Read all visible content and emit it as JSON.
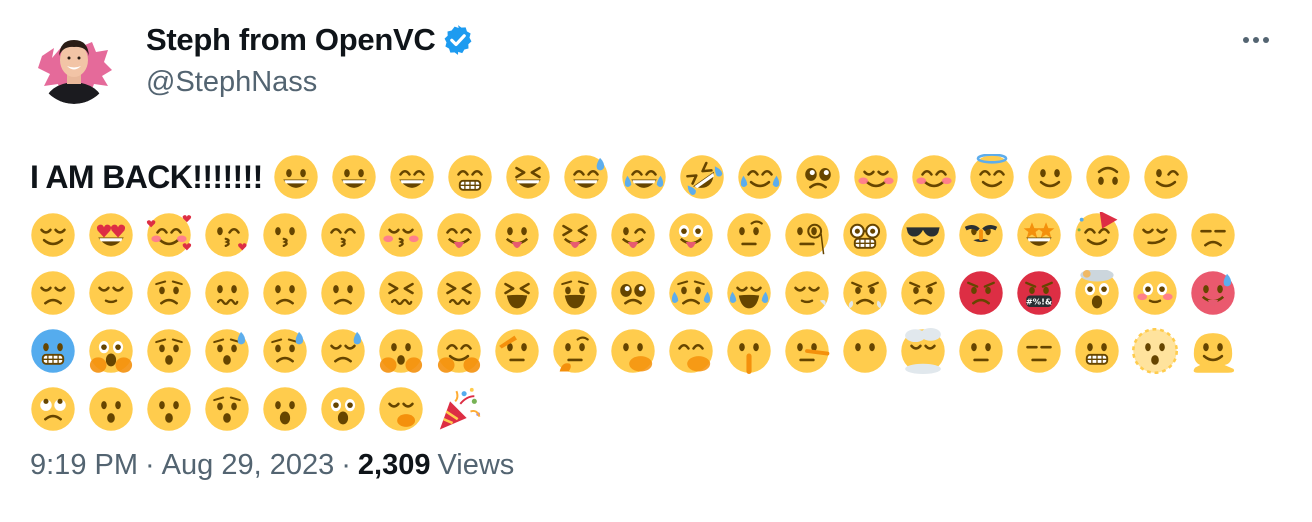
{
  "author": {
    "name": "Steph from OpenVC",
    "handle": "@StephNass",
    "verified": true
  },
  "tweet": {
    "text": "I AM BACK!!!!!!!",
    "emoji_rows": [
      [
        "grinning",
        "smiley",
        "smile",
        "grin",
        "laughing",
        "sweat-smile",
        "joy",
        "rofl",
        "smiling-tear",
        "holding-back-tears",
        "relaxed",
        "blush",
        "innocent",
        "slight-smile",
        "upside-down",
        "wink"
      ],
      [
        "relieved",
        "heart-eyes",
        "smiling-hearts",
        "kissing-heart",
        "kissing",
        "kissing-smiling",
        "kissing-closed-eyes",
        "yum",
        "tongue",
        "squinting-tongue",
        "winking-tongue",
        "zany",
        "raised-eyebrow",
        "monocle",
        "nerd",
        "sunglasses",
        "disguised",
        "star-struck",
        "partying",
        "smirk",
        "unamused"
      ],
      [
        "disappointed",
        "pensive",
        "worried",
        "confused",
        "slight-frown",
        "frowning",
        "persevere",
        "confounded",
        "tired",
        "weary",
        "pleading",
        "cry",
        "sob",
        "sleepy-breath",
        "triumph",
        "angry",
        "rage",
        "cursing",
        "exploding-head",
        "flushed",
        "hot"
      ],
      [
        "cold",
        "scream",
        "fearful",
        "anxious-sweat",
        "sad-relieved",
        "downcast-sweat",
        "peeking",
        "hugging",
        "saluting",
        "thinking",
        "hand-over-mouth",
        "giggling",
        "shushing",
        "lying",
        "no-mouth",
        "face-in-clouds",
        "neutral",
        "expressionless",
        "grimacing",
        "dotted-line",
        "melting"
      ],
      [
        "rolling-eyes",
        "hushed",
        "frowning-open",
        "anguished",
        "open-mouth",
        "astonished",
        "yawning",
        "party-popper"
      ]
    ],
    "cursing_symbols": "#%!&"
  },
  "meta": {
    "time": "9:19 PM",
    "separator": "·",
    "date": "Aug 29, 2023",
    "views_count": "2,309",
    "views_label": "Views"
  },
  "colors": {
    "emoji_yellow": "#ffcc4d",
    "feature_brown": "#664500",
    "tear_blue": "#5dadec",
    "blush_pink": "#ff7892",
    "heart_red": "#dd2e44",
    "verified_blue": "#1d9bf0",
    "secondary_text": "#536471",
    "primary_text": "#0f1419"
  }
}
